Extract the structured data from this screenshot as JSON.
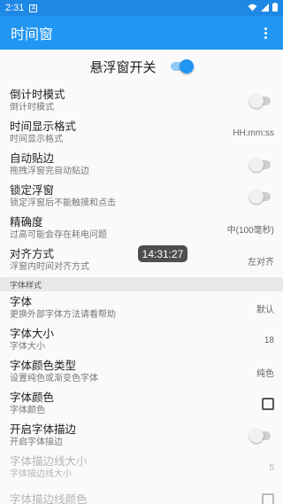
{
  "status_bar": {
    "time": "2:31",
    "notification_icon": "A",
    "icons": [
      "wifi-icon",
      "signal-icon",
      "battery-icon"
    ]
  },
  "app_bar": {
    "title": "时间窗"
  },
  "master": {
    "label": "悬浮窗开关",
    "enabled": true
  },
  "settings": [
    {
      "title": "倒计时模式",
      "sub": "倒计时模式",
      "control": "switch",
      "on": false
    },
    {
      "title": "时间显示格式",
      "sub": "时间显示格式",
      "value": "HH:mm:ss"
    },
    {
      "title": "自动贴边",
      "sub": "拖拽浮窗完自动贴边",
      "control": "switch",
      "on": false
    },
    {
      "title": "锁定浮窗",
      "sub": "锁定浮窗后不能触摸和点击",
      "control": "switch",
      "on": false
    },
    {
      "title": "精确度",
      "sub": "过高可能会存在耗电问题",
      "value": "中(100毫秒)"
    },
    {
      "title": "对齐方式",
      "sub": "浮窗内时间对齐方式",
      "value": "左对齐"
    }
  ],
  "font_section": {
    "header": "字体样式"
  },
  "font_settings": [
    {
      "title": "字体",
      "sub": "更换外部字体方法请看帮助",
      "value": "默认"
    },
    {
      "title": "字体大小",
      "sub": "字体大小",
      "value": "18"
    },
    {
      "title": "字体颜色类型",
      "sub": "设置纯色或渐变色字体",
      "value": "纯色"
    },
    {
      "title": "字体颜色",
      "sub": "字体颜色",
      "control": "checkbox"
    },
    {
      "title": "开启字体描边",
      "sub": "开启字体描边",
      "control": "switch",
      "on": false
    },
    {
      "title": "字体描边线大小",
      "sub": "字体描边线大小",
      "value": "5",
      "disabled": true
    },
    {
      "title": "字体描边线颜色",
      "sub": "",
      "control": "checkbox",
      "disabled": true
    }
  ],
  "floating_clock": {
    "time": "14:31:27"
  },
  "colors": {
    "primary": "#2196f3",
    "status_bar": "#1e88e5",
    "switch_on": "#2196f3"
  }
}
